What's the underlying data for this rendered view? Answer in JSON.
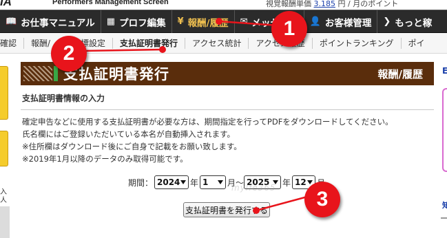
{
  "brand": {
    "logo": "IA",
    "subtitle": "Performers Management Screen",
    "header_right": "視覚報酬単価",
    "header_right_link": "3.185",
    "header_right_tail": "円 / 月のポイント"
  },
  "main_nav": [
    {
      "icon": "book-icon",
      "glyph": "📖",
      "label": "お仕事マニュアル",
      "active": false
    },
    {
      "icon": "calendar-icon",
      "glyph": "▦",
      "label": "プロフ編集",
      "active": false
    },
    {
      "icon": "yen-icon",
      "glyph": "¥",
      "label": "報酬/履歴",
      "active": true
    },
    {
      "icon": "mail-icon",
      "glyph": "✉",
      "label": "メッセージ",
      "active": false
    },
    {
      "icon": "user-icon",
      "glyph": "👤",
      "label": "お客様管理",
      "active": false
    },
    {
      "icon": "chevron-icon",
      "glyph": "❯",
      "label": "もっと稼",
      "active": false
    }
  ],
  "sub_nav": [
    {
      "label": "確認",
      "current": false
    },
    {
      "label": "報酬/",
      "current": false
    },
    {
      "label": "目標設定",
      "current": false
    },
    {
      "label": "支払証明書発行",
      "current": true
    },
    {
      "label": "アクセス統計",
      "current": false
    },
    {
      "label": "アクセス履歴",
      "current": false
    },
    {
      "label": "ポイントランキング",
      "current": false
    },
    {
      "label": "ポイ",
      "current": false
    }
  ],
  "left_column": {
    "text_a": "入",
    "text_b": "人"
  },
  "banner": {
    "title": "支払証明書発行",
    "section": "報酬/履歴"
  },
  "section_heading": "支払証明書情報の入力",
  "description": [
    "確定申告などに使用する支払証明書が必要な方は、期間指定を行ってPDFをダウンロードしてください。",
    "氏名欄にはご登録いただいている本名が自動挿入されます。",
    "※住所欄はダウンロード後にご自身で記載をお願い致します。",
    "※2019年1月以降のデータのみ取得可能です。"
  ],
  "period": {
    "label": "期間：",
    "start_year": "2024",
    "year_unit_1": "年",
    "start_month": "1",
    "month_unit_1": "月～",
    "end_year": "2025",
    "year_unit_2": "年",
    "end_month": "12",
    "month_unit_2": "月"
  },
  "submit_label": "支払証明書を発行する",
  "watermark": "mylfe365",
  "annotations": [
    {
      "number": "1",
      "target": "報酬/履歴"
    },
    {
      "number": "2",
      "target": "支払証明書発行"
    },
    {
      "number": "3",
      "target": "支払証明書を発行する"
    }
  ],
  "annotation_color": "#e8141b",
  "accent_brown": "#5a2d0c",
  "accent_green": "#39a845"
}
